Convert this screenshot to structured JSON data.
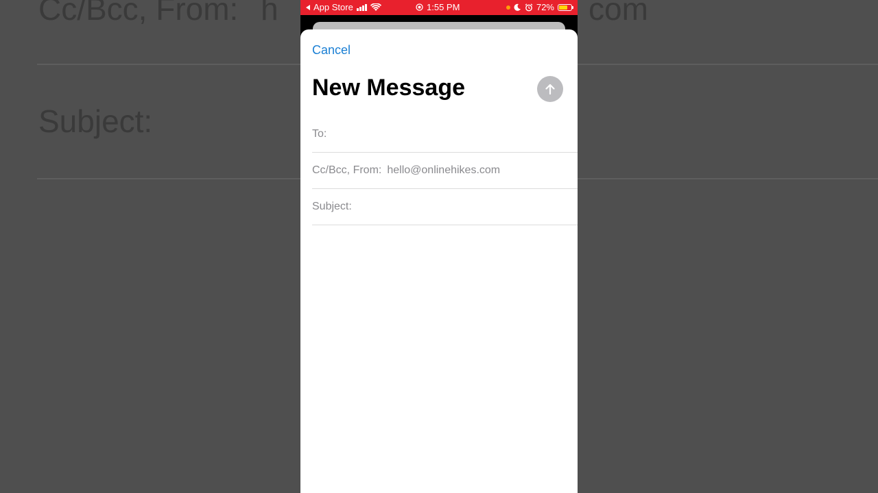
{
  "background": {
    "ccbcc_from_label": "Cc/Bcc, From:",
    "from_fragment_left": "h",
    "from_fragment_right": "com",
    "subject_label": "Subject:"
  },
  "status_bar": {
    "back_app": "App Store",
    "time": "1:55 PM",
    "battery_percent": "72%",
    "battery_level": 0.72,
    "bar_color": "#e8212d",
    "icons": [
      "back-triangle-icon",
      "signal-bars-icon",
      "wifi-icon",
      "location-icon",
      "orange-dot-icon",
      "moon-icon",
      "alarm-icon",
      "battery-icon"
    ]
  },
  "compose": {
    "cancel_label": "Cancel",
    "title": "New Message",
    "send_icon": "arrow-up-icon",
    "to_label": "To:",
    "ccbcc_from_label": "Cc/Bcc, From:",
    "from_value": "hello@onlinehikes.com",
    "subject_label": "Subject:",
    "accent_color": "#1a7fd4"
  }
}
